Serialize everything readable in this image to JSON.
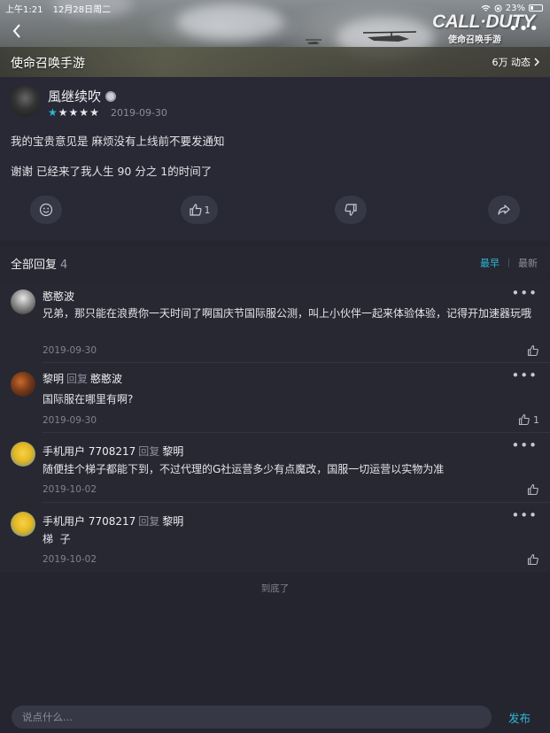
{
  "status_bar": {
    "time": "上午1:21",
    "date": "12月28日周二",
    "battery": "23%"
  },
  "header": {
    "game_name": "使命召唤手游",
    "logo_line1": "CALL·DUTY",
    "logo_line2": "使命召唤手游",
    "activity_count": "6万 动态"
  },
  "post": {
    "author": "風继续吹",
    "rating": 5,
    "date": "2019-09-30",
    "line1": "我的宝贵意见是 麻烦没有上线前不要发通知",
    "line2": "谢谢 已经来了我人生 90 分之 1的时间了",
    "like_count": "1"
  },
  "replies_section": {
    "title": "全部回复",
    "count": "4",
    "sort_earliest": "最早",
    "sort_latest": "最新"
  },
  "replies": [
    {
      "user": "憨憨波",
      "reply_label": "",
      "reply_to": "",
      "text": "兄弟，那只能在浪费你一天时间了啊国庆节国际服公测，叫上小伙伴一起来体验体验，记得开加速器玩哦",
      "date": "2019-09-30",
      "likes": ""
    },
    {
      "user": "黎明",
      "reply_label": "回复",
      "reply_to": "憨憨波",
      "text": "国际服在哪里有啊?",
      "date": "2019-09-30",
      "likes": "1"
    },
    {
      "user": "手机用户 7708217",
      "reply_label": "回复",
      "reply_to": "黎明",
      "text": "随便挂个梯子都能下到，不过代理的G社运营多少有点魔改，国服一切运营以实物为准",
      "date": "2019-10-02",
      "likes": ""
    },
    {
      "user": "手机用户 7708217",
      "reply_label": "回复",
      "reply_to": "黎明",
      "text": "梯  子",
      "date": "2019-10-02",
      "likes": ""
    }
  ],
  "end_text": "到底了",
  "composer": {
    "placeholder": "说点什么...",
    "publish": "发布"
  },
  "colors": {
    "accent": "#2fb8d6",
    "background": "#24252f"
  }
}
